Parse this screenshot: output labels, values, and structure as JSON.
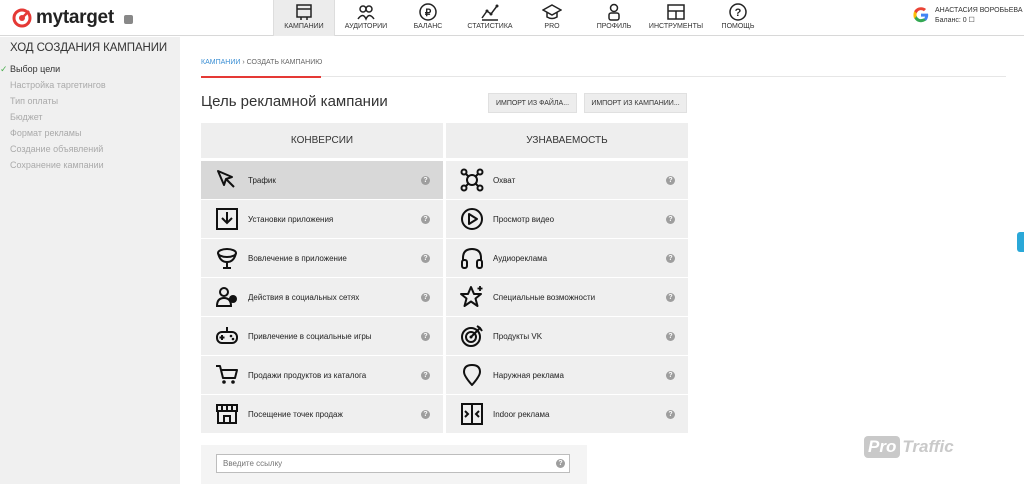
{
  "app": {
    "logo_text": "mytarget"
  },
  "nav": [
    {
      "label": "КАМПАНИИ",
      "icon": "campaigns-icon",
      "active": true
    },
    {
      "label": "АУДИТОРИИ",
      "icon": "audiences-icon"
    },
    {
      "label": "БАЛАНС",
      "icon": "balance-ruble-icon"
    },
    {
      "label": "СТАТИСТИКА",
      "icon": "statistics-icon"
    },
    {
      "label": "PRO",
      "icon": "graduation-cap-icon"
    },
    {
      "label": "ПРОФИЛЬ",
      "icon": "profile-icon"
    },
    {
      "label": "ИНСТРУМЕНТЫ",
      "icon": "tools-icon"
    },
    {
      "label": "ПОМОЩЬ",
      "icon": "help-icon"
    }
  ],
  "user": {
    "name": "АНАСТАСИЯ ВОРОБЬЕВА",
    "balance": "Баланс: 0 ☐",
    "icon": "google-icon"
  },
  "sidebar": {
    "title": "ХОД СОЗДАНИЯ КАМПАНИИ",
    "steps": [
      "Выбор цели",
      "Настройка таргетингов",
      "Тип оплаты",
      "Бюджет",
      "Формат рекламы",
      "Создание объявлений",
      "Сохранение кампании"
    ]
  },
  "breadcrumb": {
    "link": "КАМПАНИИ",
    "sep": "›",
    "current": "СОЗДАТЬ КАМПАНИЮ"
  },
  "page": {
    "title": "Цель рекламной кампании",
    "import_file": "ИМПОРТ ИЗ ФАЙЛА...",
    "import_campaign": "ИМПОРТ ИЗ КАМПАНИИ..."
  },
  "goals": {
    "conversions": {
      "title": "КОНВЕРСИИ",
      "items": [
        {
          "label": "Трафик",
          "icon": "cursor-icon"
        },
        {
          "label": "Установки приложения",
          "icon": "download-icon"
        },
        {
          "label": "Вовлечение в приложение",
          "icon": "engagement-icon"
        },
        {
          "label": "Действия в социальных сетях",
          "icon": "social-people-icon"
        },
        {
          "label": "Привлечение в социальные игры",
          "icon": "gamepad-icon"
        },
        {
          "label": "Продажи продуктов из каталога",
          "icon": "cart-icon"
        },
        {
          "label": "Посещение точек продаж",
          "icon": "store-icon"
        }
      ]
    },
    "awareness": {
      "title": "УЗНАВАЕМОСТЬ",
      "items": [
        {
          "label": "Охват",
          "icon": "reach-icon"
        },
        {
          "label": "Просмотр видео",
          "icon": "play-icon"
        },
        {
          "label": "Аудиореклама",
          "icon": "headphones-icon"
        },
        {
          "label": "Специальные возможности",
          "icon": "star-icon"
        },
        {
          "label": "Продукты VK",
          "icon": "target-icon"
        },
        {
          "label": "Наружная реклама",
          "icon": "map-pin-icon"
        },
        {
          "label": "Indoor реклама",
          "icon": "indoor-door-icon"
        }
      ]
    },
    "help_glyph": "?"
  },
  "link_input": {
    "placeholder": "Введите ссылку"
  },
  "watermark": {
    "part1": "Pro",
    "part2": "Traffic"
  }
}
